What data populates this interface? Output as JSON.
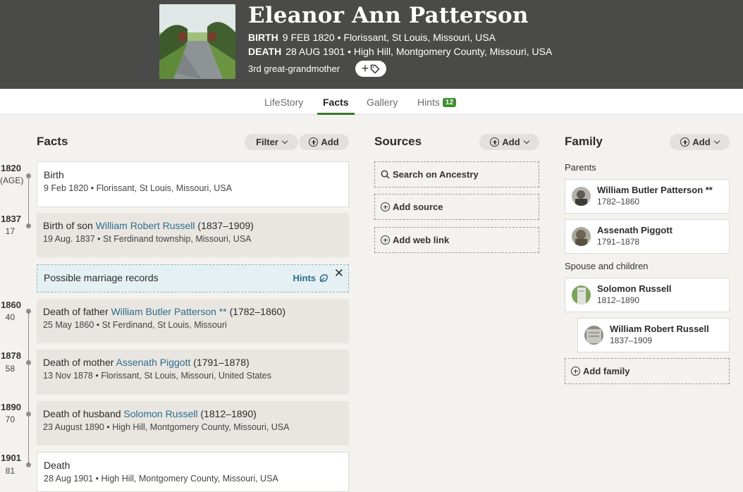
{
  "profile": {
    "name": "Eleanor Ann Patterson",
    "birth_label": "BIRTH",
    "birth_text": "9 FEB 1820 • Florissant, St Louis, Missouri, USA",
    "death_label": "DEATH",
    "death_text": "28 AUG 1901 • High Hill, Montgomery County, Missouri, USA",
    "relation": "3rd great-grandmother",
    "tag_button": "+"
  },
  "tabs": [
    {
      "label": "LifeStory"
    },
    {
      "label": "Facts"
    },
    {
      "label": "Gallery"
    },
    {
      "label": "Hints",
      "badge": "12"
    }
  ],
  "facts": {
    "title": "Facts",
    "filter_label": "Filter",
    "add_label": "Add",
    "timeline": [
      {
        "year": "1820",
        "age": "(AGE)"
      },
      {
        "year": "1837",
        "age": "17"
      },
      {
        "year": "1860",
        "age": "40"
      },
      {
        "year": "1878",
        "age": "58"
      },
      {
        "year": "1890",
        "age": "70"
      },
      {
        "year": "1901",
        "age": "81"
      }
    ],
    "items": [
      {
        "prefix": "Birth",
        "link": "",
        "suffix": "",
        "detail": "9 Feb 1820 • Florissant, St Louis, Missouri, USA"
      },
      {
        "prefix": "Birth of son ",
        "link": "William Robert Russell",
        "suffix": " (1837–1909)",
        "detail": "19 Aug. 1837 • St Ferdinand township, Missouri, USA"
      },
      {
        "prefix": "Death of father ",
        "link": "William Butler Patterson **",
        "suffix": " (1782–1860)",
        "detail": "25 May 1860 • St Ferdinand, St Louis, Missouri"
      },
      {
        "prefix": "Death of mother ",
        "link": "Assenath Piggott",
        "suffix": " (1791–1878)",
        "detail": "13 Nov 1878 • Florissant, St Louis, Missouri, United States"
      },
      {
        "prefix": "Death of husband ",
        "link": "Solomon Russell",
        "suffix": " (1812–1890)",
        "detail": "23 August 1890 • High Hill, Montgomery County, Missouri, USA"
      },
      {
        "prefix": "Death",
        "link": "",
        "suffix": "",
        "detail": "28 Aug 1901 • High Hill, Montgomery County, Missouri, USA"
      }
    ],
    "hint_card": {
      "text": "Possible marriage records",
      "link": "Hints",
      "close": "✕"
    }
  },
  "sources": {
    "title": "Sources",
    "add_label": "Add",
    "search_label": "Search on Ancestry",
    "add_source_label": "Add source",
    "add_web_link_label": "Add web link"
  },
  "family": {
    "title": "Family",
    "add_label": "Add",
    "parents_label": "Parents",
    "spouse_label": "Spouse and children",
    "parents": [
      {
        "name": "William Butler Patterson **",
        "years": "1782–1860"
      },
      {
        "name": "Assenath Piggott",
        "years": "1791–1878"
      }
    ],
    "spouse": {
      "name": "Solomon Russell",
      "years": "1812–1890"
    },
    "children": [
      {
        "name": "William Robert Russell",
        "years": "1837–1909"
      }
    ],
    "add_family_label": "Add family"
  },
  "colors": {
    "header_bg": "#4a4a48",
    "page_bg": "#f4f2ee",
    "link": "#2e6c8c",
    "active_tab": "#3a7a2e",
    "hint_bg": "#e5f0f2"
  }
}
